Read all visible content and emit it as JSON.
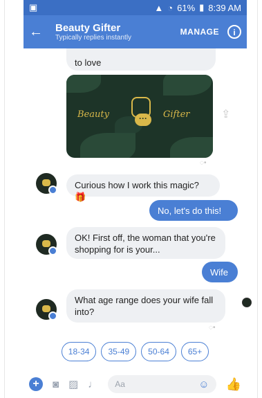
{
  "status_bar": {
    "time": "8:39 AM",
    "battery": "61%"
  },
  "header": {
    "title": "Beauty Gifter",
    "subtitle": "Typically replies instantly",
    "manage_label": "MANAGE",
    "back_icon": "arrow-left-icon",
    "info_icon": "info-icon"
  },
  "messages": {
    "partial_top": "to love",
    "image_text_left": "Beauty",
    "image_text_right": "Gifter",
    "bot1": "Curious how I work this magic? 🎁",
    "me1": "No, let's do this!",
    "bot2": "OK! First off, the woman that you're shopping for is your...",
    "me2": "Wife",
    "bot3": "What age range does your wife fall into?"
  },
  "quick_replies": [
    "18-34",
    "35-49",
    "50-64",
    "65+"
  ],
  "composer": {
    "placeholder": "Aa"
  },
  "colors": {
    "accent": "#4a7fd4",
    "bubble_bot": "#eef0f3"
  }
}
